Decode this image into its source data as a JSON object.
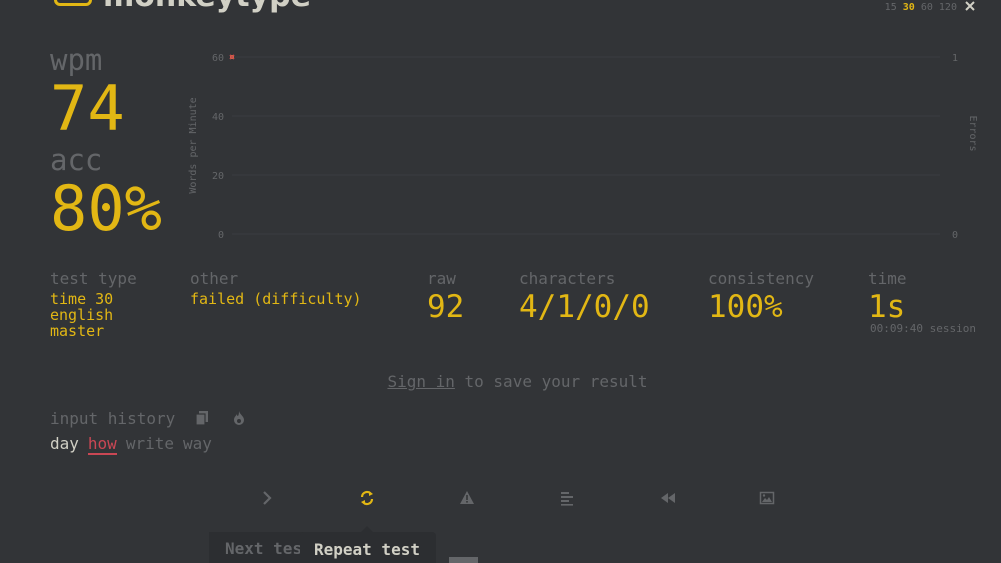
{
  "header": {
    "app_title": "monkeytype",
    "time_options": [
      "15",
      "30",
      "60",
      "120"
    ],
    "time_selected": "30"
  },
  "stats": {
    "wpm_label": "wpm",
    "wpm_value": "74",
    "acc_label": "acc",
    "acc_value": "80%"
  },
  "chart_data": {
    "type": "line",
    "ylabel": "Words per Minute",
    "y2label": "Errors",
    "ylim": [
      0,
      60
    ],
    "y2lim": [
      0,
      1
    ],
    "yticks": [
      "60",
      "40",
      "20",
      "0"
    ],
    "y2ticks": [
      "1",
      "0"
    ],
    "series": [
      {
        "x": [
          1
        ],
        "values": [
          60
        ]
      }
    ],
    "errors": [
      {
        "x": 1,
        "count": 1
      }
    ],
    "grid": true,
    "colors": {
      "line": "#e2b714",
      "error": "#ca4754",
      "axis": "#646669",
      "grid": "#3b3d40"
    }
  },
  "details": {
    "test_type_label": "test type",
    "test_type_lines": [
      "time 30",
      "english",
      "master"
    ],
    "other_label": "other",
    "other_value": "failed (difficulty)",
    "raw_label": "raw",
    "raw_value": "92",
    "characters_label": "characters",
    "characters_value": "4/1/0/0",
    "consistency_label": "consistency",
    "consistency_value": "100%",
    "time_label": "time",
    "time_value": "1s",
    "session_text": "00:09:40 session"
  },
  "signin": {
    "link_text": "Sign in",
    "rest_text": " to save your result"
  },
  "history": {
    "label": "input history",
    "words": [
      {
        "text": "day",
        "state": "correct"
      },
      {
        "text": "how",
        "state": "error"
      },
      {
        "text": "write",
        "state": "untyped"
      },
      {
        "text": "way",
        "state": "untyped"
      }
    ]
  },
  "buttons": [
    {
      "name": "next-test-button",
      "icon": "chevron-right-icon"
    },
    {
      "name": "repeat-test-button",
      "icon": "refresh-icon"
    },
    {
      "name": "practice-missed-button",
      "icon": "warning-icon"
    },
    {
      "name": "words-history-button",
      "icon": "align-left-icon"
    },
    {
      "name": "replay-button",
      "icon": "backward-icon"
    },
    {
      "name": "screenshot-button",
      "icon": "image-icon"
    }
  ],
  "tooltips": {
    "next_test": "Next test",
    "repeat_test": "Repeat test"
  },
  "colors": {
    "background": "#323437",
    "main": "#e2b714",
    "sub": "#646669",
    "text": "#d1d0c5",
    "error": "#ca4754"
  }
}
